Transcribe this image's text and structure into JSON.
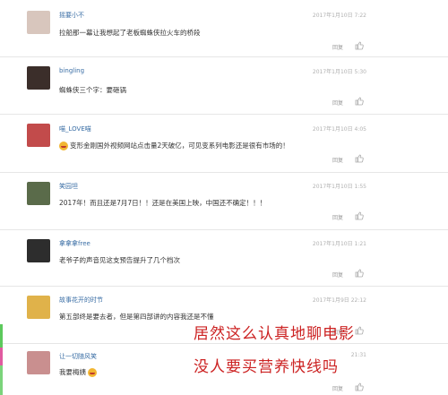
{
  "comments": [
    {
      "user": "摇要小不",
      "time": "2017年1月10日 7:22",
      "text": "拉船那一幕让我想起了老板蜘蛛侠拉火车的桥段",
      "reply": "回复",
      "avatar_color": "#d8c6bd"
    },
    {
      "user": "bingling",
      "time": "2017年1月10日 5:30",
      "text": "蜘蛛侠三个字：要砸锅",
      "reply": "回复",
      "avatar_color": "#3b2e2a"
    },
    {
      "user": "喵_LOVE喵",
      "time": "2017年1月10日 4:05",
      "text": "变形金刚国外视频网站点击量2天破亿，可见变系列电影还是很有市场的！",
      "reply": "回复",
      "avatar_color": "#c24b4b",
      "emoji": "smile-emoji"
    },
    {
      "user": "笑园坦",
      "time": "2017年1月10日 1:55",
      "text": "2017年！而且还是7月7日！！还是在美国上映，中国还不确定！！！",
      "reply": "回复",
      "avatar_color": "#5a6b4a"
    },
    {
      "user": "拿拿拿free",
      "time": "2017年1月10日 1:21",
      "text": "老爷子的声音见这支预告提升了几个档次",
      "reply": "回复",
      "avatar_color": "#2d2d2d"
    },
    {
      "user": "故事花开的时节",
      "time": "2017年1月9日 22:12",
      "text": "第五部终是要去者，但是第四部讲的内容我还是不懂",
      "reply": "回复",
      "avatar_color": "#e0b24a"
    },
    {
      "user": "让一切随风笑",
      "time": "21:31",
      "text": "我要梅姨",
      "reply": "回复",
      "avatar_color": "#c98f8f",
      "emoji": "grin-emoji"
    }
  ],
  "overlay": {
    "line1": "居然这么认真地聊电影",
    "line2": "没人要买营养快线吗",
    "color": "#cc2222"
  },
  "colors": {
    "username": "#3a6ea5",
    "timestamp": "#b0b0b0",
    "divider": "#e6e6e6"
  }
}
